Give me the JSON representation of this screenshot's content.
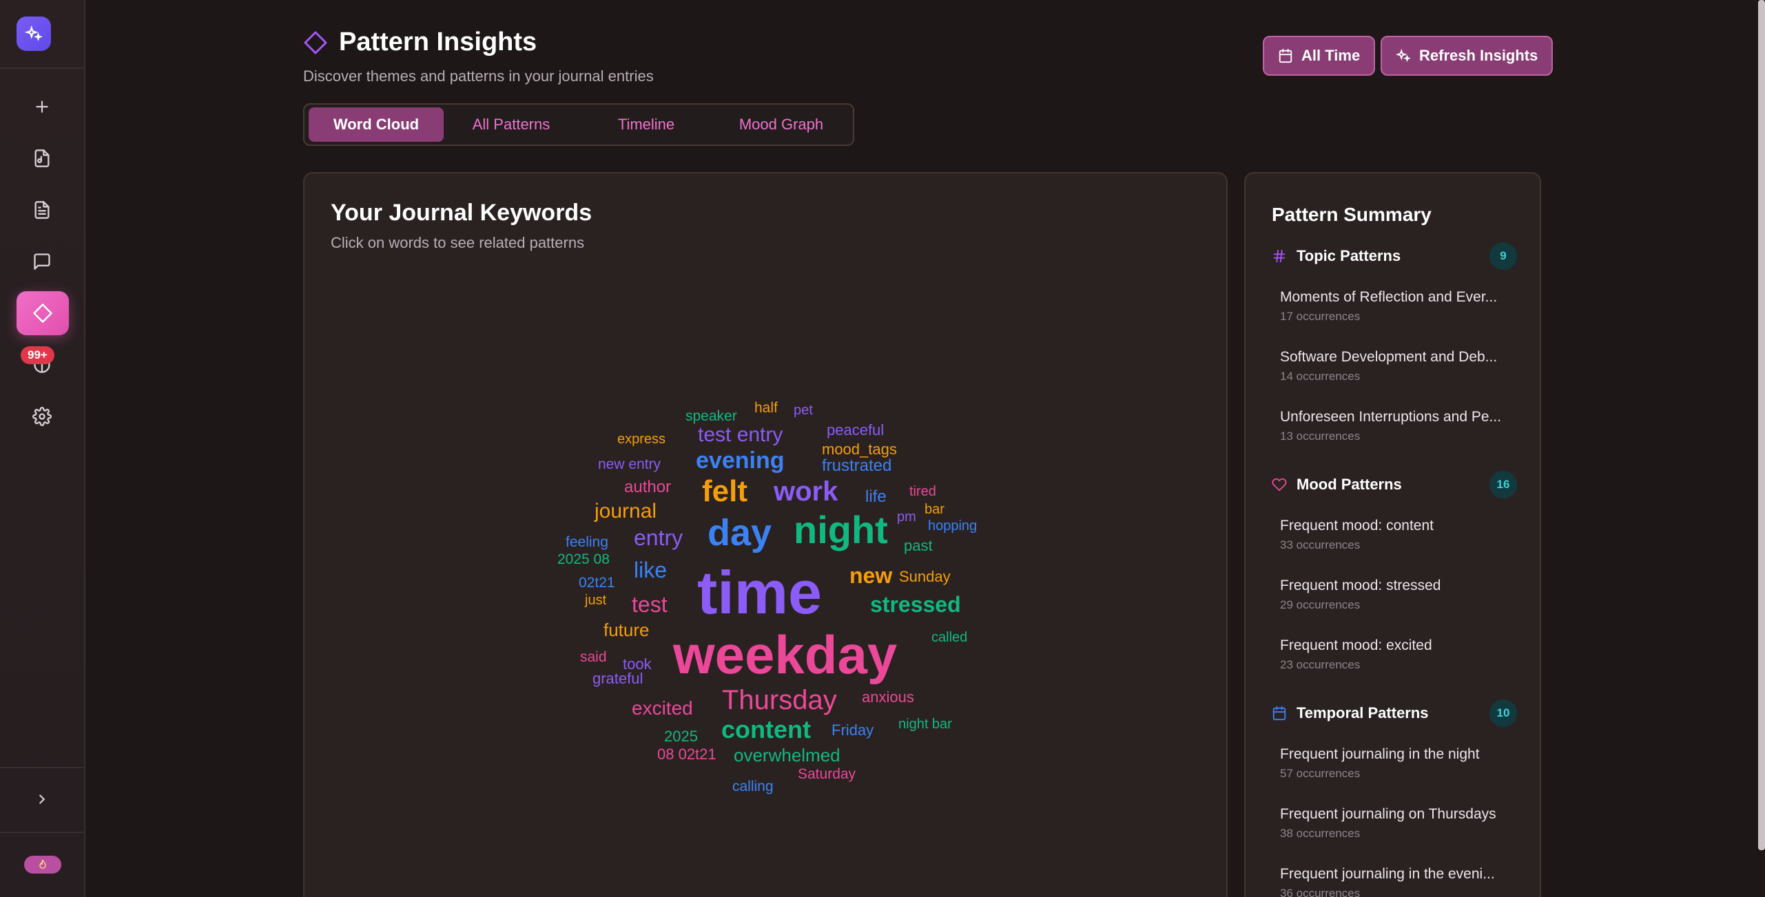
{
  "app": {
    "title": "Pattern Insights",
    "subtitle": "Discover themes and patterns in your journal entries",
    "icons": [
      "sparkles-logo-icon",
      "diamond-icon",
      "calendar-icon",
      "sparkles-icon"
    ]
  },
  "sidebar": {
    "notification_badge": "99+",
    "items": [
      {
        "name": "new-entry",
        "icon": "plus-icon"
      },
      {
        "name": "audio-file",
        "icon": "audio-file-icon"
      },
      {
        "name": "entries",
        "icon": "document-icon"
      },
      {
        "name": "chat",
        "icon": "chat-icon"
      },
      {
        "name": "patterns",
        "icon": "diamond-icon",
        "active": true
      },
      {
        "name": "insights",
        "icon": "brain-icon"
      },
      {
        "name": "settings",
        "icon": "gear-icon"
      }
    ]
  },
  "header": {
    "time_range_label": "All Time",
    "refresh_label": "Refresh Insights"
  },
  "tabs": [
    {
      "label": "Word Cloud",
      "active": true
    },
    {
      "label": "All Patterns"
    },
    {
      "label": "Timeline"
    },
    {
      "label": "Mood Graph"
    }
  ],
  "keywords_card": {
    "title": "Your Journal Keywords",
    "subtitle": "Click on words to see related patterns",
    "words": [
      {
        "text": "time",
        "color": "#8b5cf6"
      },
      {
        "text": "weekday",
        "color": "#ec4899"
      },
      {
        "text": "night",
        "color": "#10b981"
      },
      {
        "text": "day",
        "color": "#3b82f6"
      },
      {
        "text": "felt",
        "color": "#f59e0b"
      },
      {
        "text": "work",
        "color": "#8b5cf6"
      },
      {
        "text": "evening",
        "color": "#3b82f6"
      },
      {
        "text": "test entry",
        "color": "#8b5cf6"
      },
      {
        "text": "Thursday",
        "color": "#ec4899"
      },
      {
        "text": "content",
        "color": "#10b981"
      },
      {
        "text": "stressed",
        "color": "#10b981"
      },
      {
        "text": "new",
        "color": "#f59e0b"
      },
      {
        "text": "test",
        "color": "#ec4899"
      },
      {
        "text": "journal",
        "color": "#f59e0b"
      },
      {
        "text": "entry",
        "color": "#8b5cf6"
      },
      {
        "text": "like",
        "color": "#3b82f6"
      },
      {
        "text": "excited",
        "color": "#ec4899"
      },
      {
        "text": "overwhelmed",
        "color": "#10b981"
      },
      {
        "text": "frustrated",
        "color": "#3b82f6"
      },
      {
        "text": "future",
        "color": "#f59e0b"
      },
      {
        "text": "author",
        "color": "#ec4899"
      },
      {
        "text": "Sunday",
        "color": "#f59e0b"
      },
      {
        "text": "mood_tags",
        "color": "#f59e0b"
      },
      {
        "text": "past",
        "color": "#10b981"
      },
      {
        "text": "life",
        "color": "#3b82f6"
      },
      {
        "text": "anxious",
        "color": "#ec4899"
      },
      {
        "text": "Friday",
        "color": "#3b82f6"
      },
      {
        "text": "peaceful",
        "color": "#8b5cf6"
      },
      {
        "text": "new entry",
        "color": "#8b5cf6"
      },
      {
        "text": "express",
        "color": "#f59e0b"
      },
      {
        "text": "speaker",
        "color": "#10b981"
      },
      {
        "text": "half",
        "color": "#f59e0b"
      },
      {
        "text": "pet",
        "color": "#8b5cf6"
      },
      {
        "text": "feeling",
        "color": "#3b82f6"
      },
      {
        "text": "2025 08",
        "color": "#10b981"
      },
      {
        "text": "02t21",
        "color": "#3b82f6"
      },
      {
        "text": "just",
        "color": "#f59e0b"
      },
      {
        "text": "said",
        "color": "#ec4899"
      },
      {
        "text": "took",
        "color": "#8b5cf6"
      },
      {
        "text": "grateful",
        "color": "#8b5cf6"
      },
      {
        "text": "tired",
        "color": "#ec4899"
      },
      {
        "text": "bar",
        "color": "#f59e0b"
      },
      {
        "text": "pm",
        "color": "#8b5cf6"
      },
      {
        "text": "hopping",
        "color": "#3b82f6"
      },
      {
        "text": "called",
        "color": "#10b981"
      },
      {
        "text": "night bar",
        "color": "#10b981"
      },
      {
        "text": "2025",
        "color": "#10b981"
      },
      {
        "text": "08 02t21",
        "color": "#ec4899"
      },
      {
        "text": "Saturday",
        "color": "#ec4899"
      },
      {
        "text": "calling",
        "color": "#3b82f6"
      }
    ]
  },
  "summary": {
    "title": "Pattern Summary",
    "sections": [
      {
        "label": "Topic Patterns",
        "icon": "hash-icon",
        "icon_color": "#a855f7",
        "count": "9",
        "items": [
          {
            "name": "Moments of Reflection and Ever...",
            "occ": "17 occurrences"
          },
          {
            "name": "Software Development and Deb...",
            "occ": "14 occurrences"
          },
          {
            "name": "Unforeseen Interruptions and Pe...",
            "occ": "13 occurrences"
          }
        ]
      },
      {
        "label": "Mood Patterns",
        "icon": "heart-icon",
        "icon_color": "#ec4899",
        "count": "16",
        "items": [
          {
            "name": "Frequent mood: content",
            "occ": "33 occurrences"
          },
          {
            "name": "Frequent mood: stressed",
            "occ": "29 occurrences"
          },
          {
            "name": "Frequent mood: excited",
            "occ": "23 occurrences"
          }
        ]
      },
      {
        "label": "Temporal Patterns",
        "icon": "calendar-icon",
        "icon_color": "#3b82f6",
        "count": "10",
        "items": [
          {
            "name": "Frequent journaling in the night",
            "occ": "57 occurrences"
          },
          {
            "name": "Frequent journaling on Thursdays",
            "occ": "38 occurrences"
          },
          {
            "name": "Frequent journaling in the eveni...",
            "occ": "36 occurrences"
          }
        ]
      }
    ]
  }
}
